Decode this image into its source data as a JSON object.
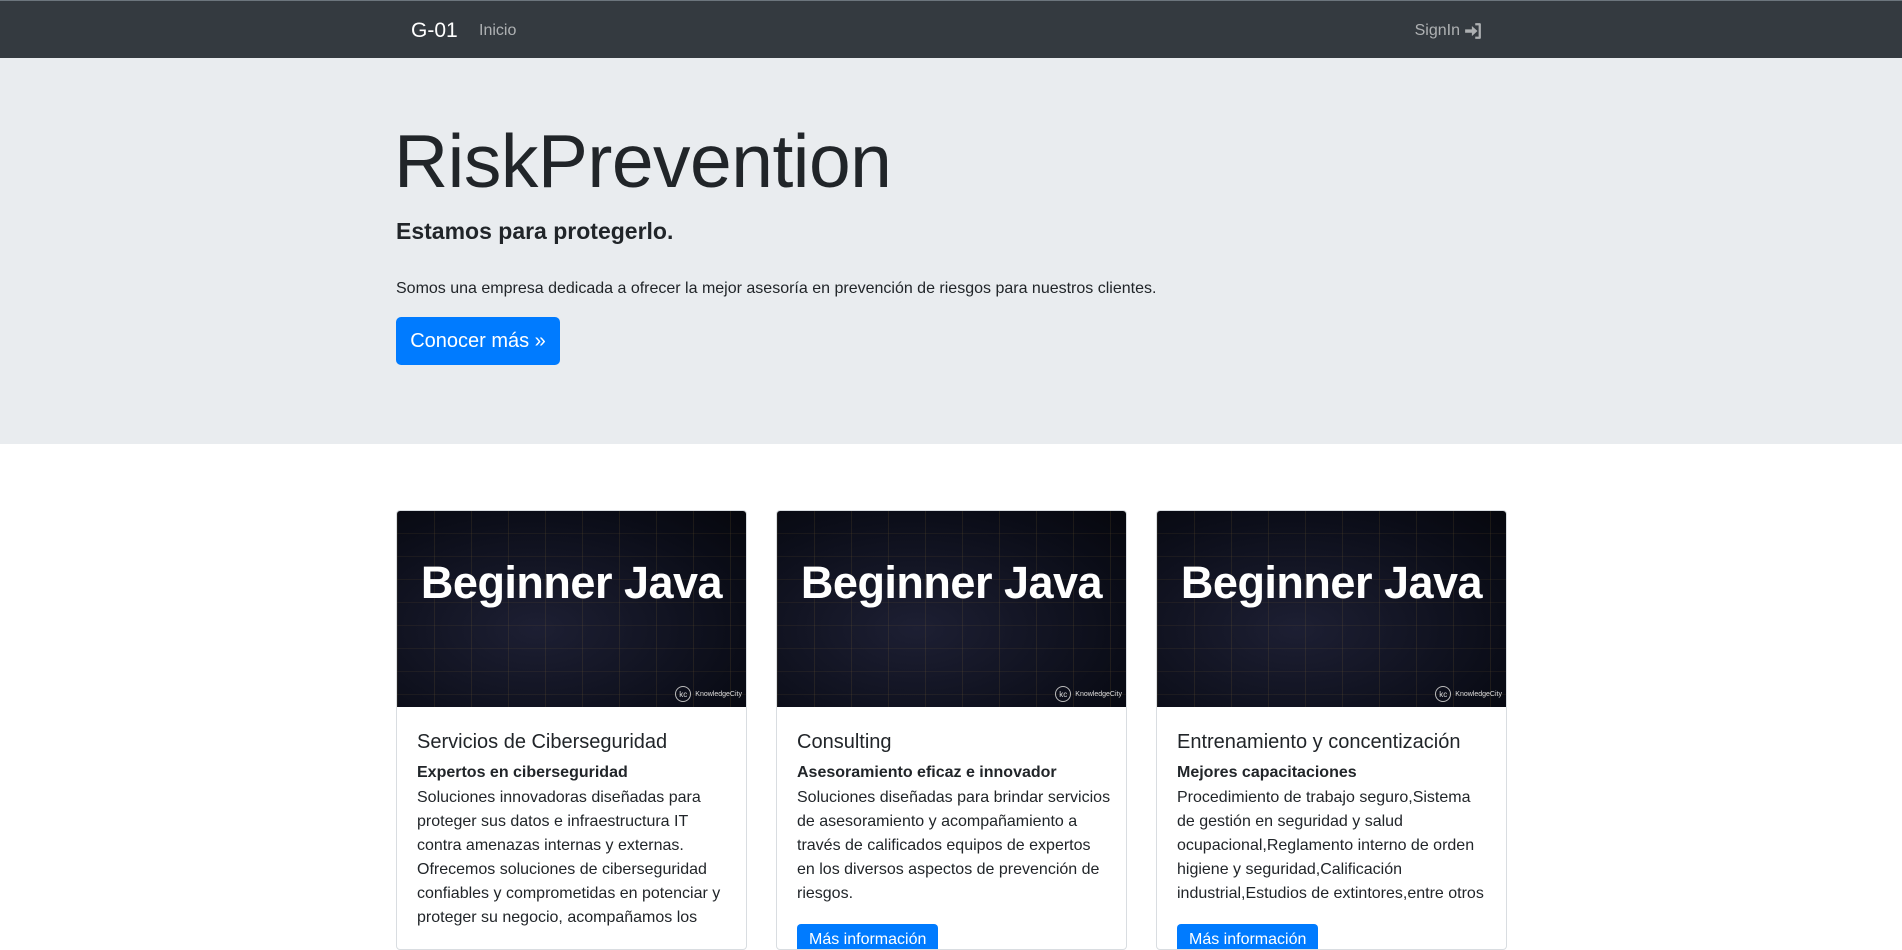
{
  "navbar": {
    "brand": "G-01",
    "links": [
      "Inicio"
    ],
    "signin_label": "SignIn"
  },
  "jumbotron": {
    "title": "RiskPrevention",
    "subtitle": "Estamos para protegerlo.",
    "lead": "Somos una empresa dedicada a ofrecer la mejor asesoría en prevención de riesgos para nuestros clientes.",
    "cta_label": "Conocer más »"
  },
  "cards": [
    {
      "image_text": "Beginner Java",
      "image_logo": "KnowledgeCity",
      "title": "Servicios de Ciberseguridad",
      "subtitle": "Expertos en ciberseguridad",
      "text": "Soluciones innovadoras diseñadas para proteger sus datos e infraestructura IT contra amenazas internas y externas. Ofrecemos soluciones de ciberseguridad confiables y comprometidas en potenciar y proteger su negocio, acompañamos los",
      "button_label": "Más información"
    },
    {
      "image_text": "Beginner Java",
      "image_logo": "KnowledgeCity",
      "title": "Consulting",
      "subtitle": "Asesoramiento eficaz e innovador",
      "text": "Soluciones diseñadas para brindar servicios de asesoramiento y acompañamiento a través de calificados equipos de expertos en los diversos aspectos de prevención de riesgos.",
      "button_label": "Más información"
    },
    {
      "image_text": "Beginner Java",
      "image_logo": "KnowledgeCity",
      "title": "Entrenamiento y concentización",
      "subtitle": "Mejores capacitaciones",
      "text": "Procedimiento de trabajo seguro,Sistema de gestión en seguridad y salud ocupacional,Reglamento interno de orden higiene y seguridad,Calificación industrial,Estudios de extintores,entre otros",
      "button_label": "Más información"
    }
  ],
  "colors": {
    "navbar_bg": "#343a40",
    "jumbotron_bg": "#e9ecef",
    "primary": "#007bff"
  }
}
